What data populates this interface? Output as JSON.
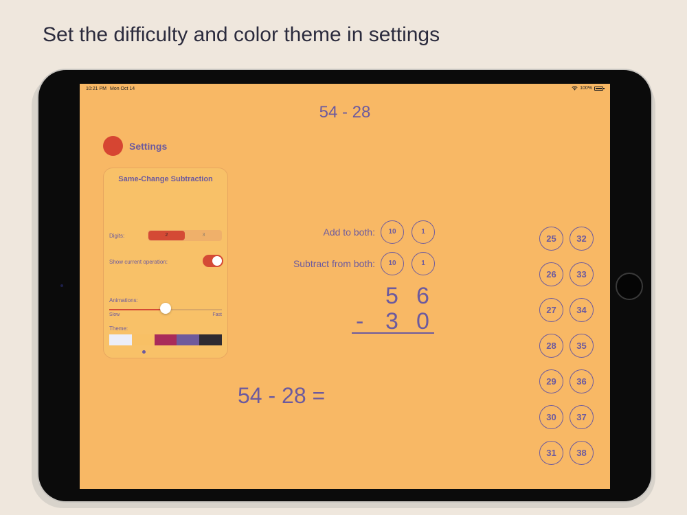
{
  "caption": "Set the difficulty and color theme in settings",
  "status_bar": {
    "time": "10:21 PM",
    "date": "Mon Oct 14",
    "battery": "100%"
  },
  "problem_header": "54 - 28",
  "settings": {
    "label": "Settings",
    "panel_title": "Same-Change Subtraction",
    "digits_label": "Digits:",
    "digits_options": [
      "2",
      "3"
    ],
    "digits_selected": "2",
    "show_operation_label": "Show current operation:",
    "show_operation_on": true,
    "animations_label": "Animations:",
    "animation_speed_fraction": 0.5,
    "slider_min": "Slow",
    "slider_max": "Fast",
    "theme_label": "Theme:",
    "theme_colors": [
      "#eceef9",
      "#f8c065",
      "#a92b5a",
      "#6f5a9c",
      "#2e2a31"
    ]
  },
  "operations": {
    "add_label": "Add to both:",
    "subtract_label": "Subtract from both:",
    "buttons": [
      "10",
      "1"
    ]
  },
  "column": {
    "top": [
      "5",
      "6"
    ],
    "operator": "-",
    "bottom": [
      "3",
      "0"
    ]
  },
  "equation": "54 - 28 =",
  "answers": {
    "left": [
      "25",
      "26",
      "27",
      "28",
      "29",
      "30",
      "31"
    ],
    "right": [
      "32",
      "33",
      "34",
      "35",
      "36",
      "37",
      "38"
    ]
  },
  "colors": {
    "background": "#f8b865",
    "accent": "#d44a35",
    "text": "#6c5a9e"
  }
}
